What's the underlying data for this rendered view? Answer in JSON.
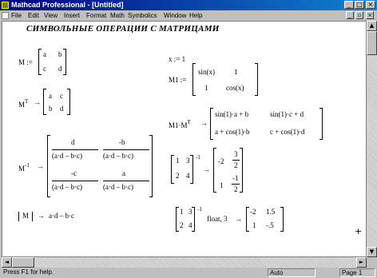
{
  "window": {
    "title": "Mathcad Professional - [Untitled]"
  },
  "menu": [
    "File",
    "Edit",
    "View",
    "Insert",
    "Format",
    "Math",
    "Symbolics",
    "Window",
    "Help"
  ],
  "heading": "СИМВОЛЬНЫЕ ОПЕРАЦИИ С МАТРИЦАМИ",
  "left": {
    "m_def_lhs": "M :=",
    "m_a": "a",
    "m_b": "b",
    "m_c": "c",
    "m_d": "d",
    "mt_lhs": "M",
    "mt_sup": "T",
    "arrow": "→",
    "mt_a": "a",
    "mt_c": "c",
    "mt_b": "b",
    "mt_d": "d",
    "minv_lhs": "M",
    "minv_sup": "-1",
    "inv11_num": "d",
    "inv11_den": "(a·d – b·c)",
    "inv12_num": "-b",
    "inv12_den": "(a·d – b·c)",
    "inv21_num": "-c",
    "inv21_den": "(a·d – b·c)",
    "inv22_num": "a",
    "inv22_den": "(a·d – b·c)",
    "det_m": "M",
    "det_result": "a·d – b·c"
  },
  "right": {
    "x_def": "x := 1",
    "m1_lhs": "M1 :=",
    "m1_11": "sin(x)",
    "m1_12": "1",
    "m1_21": "1",
    "m1_22": "cos(x)",
    "prod_lhs": "M1·M",
    "prod_sup": "T",
    "prod_11": "sin(1)·a + b",
    "prod_12": "sin(1)·c + d",
    "prod_21": "a + cos(1)·b",
    "prod_22": "c + cos(1)·d",
    "num_11": "1",
    "num_12": "3",
    "num_21": "2",
    "num_22": "4",
    "num_sup": "-1",
    "res_11": "-2",
    "res_12_num": "3",
    "res_12_den": "2",
    "res_21": "1",
    "res_22_num": "-1",
    "res_22_den": "2",
    "fl_11": "1",
    "fl_12": "3",
    "fl_21": "2",
    "fl_22": "4",
    "fl_sup": "-1",
    "fl_kw": "float, 3",
    "fl_r11": "-2",
    "fl_r12": "1.5",
    "fl_r21": "1",
    "fl_r22": "-.5"
  },
  "status": {
    "hint": "Press F1 for help.",
    "mode": "Auto",
    "page": "Page 1"
  }
}
